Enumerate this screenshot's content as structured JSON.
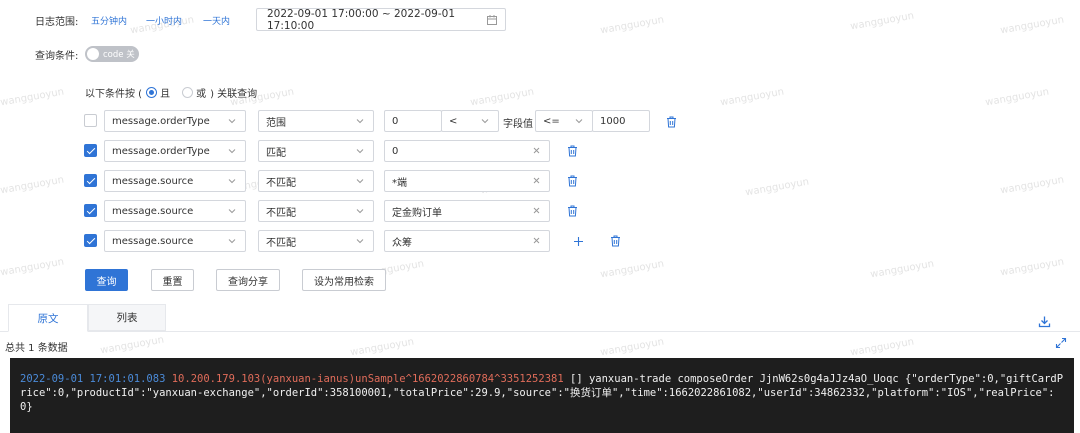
{
  "date_range": {
    "label": "日志范围:",
    "quick_links": [
      "五分钟内",
      "一小时内",
      "一天内"
    ],
    "value": "2022-09-01 17:00:00 ~ 2022-09-01 17:10:00"
  },
  "query_condition": {
    "label": "查询条件:",
    "toggle_label": "code 关"
  },
  "logic": {
    "prefix": "以下条件按 (",
    "and_label": "且",
    "or_label": "或",
    "suffix": ") 关联查询",
    "selected": "且"
  },
  "conditions": [
    {
      "checked": false,
      "field": "message.orderType",
      "op": "范围",
      "value": "0",
      "comparator": "<",
      "field_value_label": "字段值",
      "comparator2": "<=",
      "value2": "1000"
    },
    {
      "checked": true,
      "field": "message.orderType",
      "op": "匹配",
      "value": "0"
    },
    {
      "checked": true,
      "field": "message.source",
      "op": "不匹配",
      "value": "*端"
    },
    {
      "checked": true,
      "field": "message.source",
      "op": "不匹配",
      "value": "定金购订单"
    },
    {
      "checked": true,
      "field": "message.source",
      "op": "不匹配",
      "value": "众筹"
    }
  ],
  "buttons": {
    "query": "查询",
    "reset": "重置",
    "share": "查询分享",
    "save": "设为常用检索"
  },
  "tabs": [
    "原文",
    "列表"
  ],
  "active_tab": "原文",
  "total_text": "总共 1 条数据",
  "watermark": "wangguoyun",
  "log": {
    "timestamp": "2022-09-01 17:01:01.083",
    "host": "10.200.179.103(yanxuan-ianus)unSample^1662022860784^3351252381",
    "body": " [] yanxuan-trade composeOrder JjnW62s0g4aJJz4aO_Uoqc {\"orderType\":0,\"giftCardPrice\":0,\"productId\":\"yanxuan-exchange\",\"orderId\":358100001,\"totalPrice\":29.9,\"source\":\"换货订单\",\"time\":1662022861082,\"userId\":34862332,\"platform\":\"IOS\",\"realPrice\":0}"
  },
  "colors": {
    "accent": "#2f74d6",
    "console_bg": "#1e1e1e",
    "timestamp": "#4b8bd9",
    "host": "#e06c5a"
  }
}
